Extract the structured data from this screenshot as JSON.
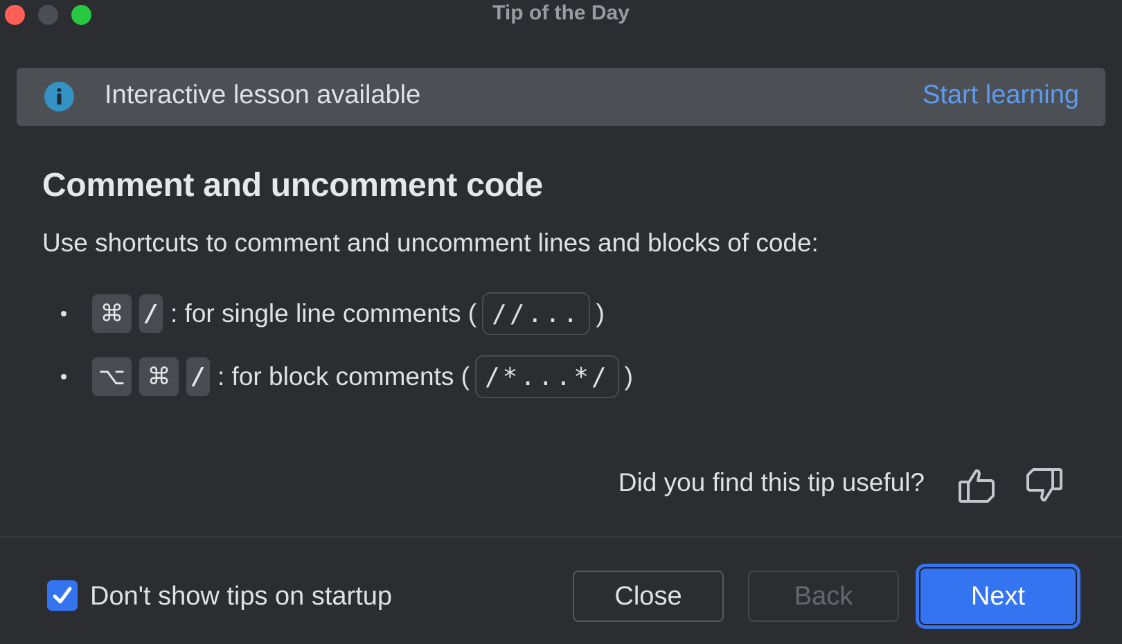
{
  "window": {
    "title": "Tip of the Day",
    "controls": [
      "close",
      "minimize",
      "zoom"
    ]
  },
  "banner": {
    "icon": "info-icon",
    "text": "Interactive lesson available",
    "link_label": "Start learning"
  },
  "tip": {
    "title": "Comment and uncomment code",
    "description": "Use shortcuts to comment and uncomment lines and blocks of code:",
    "shortcuts": [
      {
        "keys": [
          "⌘",
          "/"
        ],
        "text": ": for single line comments (",
        "code": "//...",
        "close": ")"
      },
      {
        "keys": [
          "⌥",
          "⌘",
          "/"
        ],
        "text": ": for block comments (",
        "code": "/*...*/",
        "close": ")"
      }
    ]
  },
  "feedback": {
    "question": "Did you find this tip useful?",
    "like_icon": "thumbs-up-icon",
    "dislike_icon": "thumbs-down-icon"
  },
  "footer": {
    "checkbox_label": "Don't show tips on startup",
    "checkbox_checked": true,
    "close_label": "Close",
    "back_label": "Back",
    "back_disabled": true,
    "next_label": "Next"
  },
  "colors": {
    "accent": "#3574f0",
    "link": "#5e9bf0",
    "info": "#3592c4",
    "background": "#2b2d30",
    "banner": "#4c5055"
  }
}
